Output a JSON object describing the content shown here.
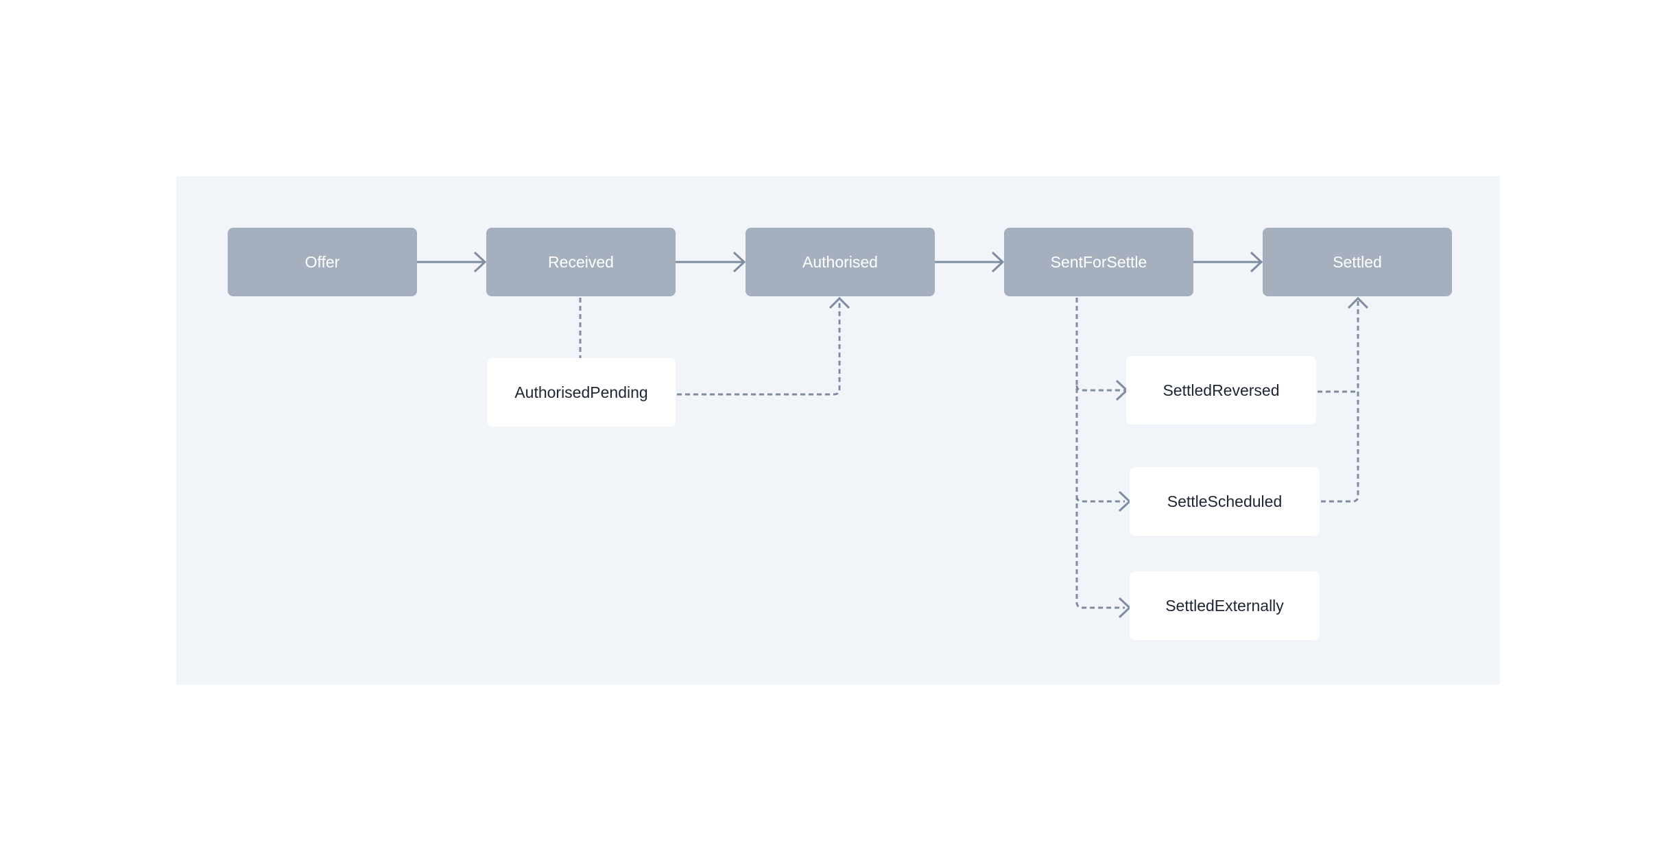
{
  "colors": {
    "panel_bg": "#f1f4f8",
    "main_node": "#a6afbd",
    "sub_node": "#ffffff",
    "edge": "#7f8ba0",
    "sub_text": "#1d2433"
  },
  "nodes": {
    "offer": "Offer",
    "received": "Received",
    "authorised": "Authorised",
    "sent_for_settle": "SentForSettle",
    "settled": "Settled",
    "authorised_pending": "AuthorisedPending",
    "settled_reversed": "SettledReversed",
    "settle_scheduled": "SettleScheduled",
    "settled_externally": "SettledExternally"
  },
  "edges": [
    {
      "from": "Offer",
      "to": "Received",
      "style": "solid"
    },
    {
      "from": "Received",
      "to": "Authorised",
      "style": "solid"
    },
    {
      "from": "Authorised",
      "to": "SentForSettle",
      "style": "solid"
    },
    {
      "from": "SentForSettle",
      "to": "Settled",
      "style": "solid"
    },
    {
      "from": "Received",
      "to": "AuthorisedPending",
      "style": "dashed"
    },
    {
      "from": "AuthorisedPending",
      "to": "Authorised",
      "style": "dashed"
    },
    {
      "from": "SentForSettle",
      "to": "SettledReversed",
      "style": "dashed"
    },
    {
      "from": "SentForSettle",
      "to": "SettleScheduled",
      "style": "dashed"
    },
    {
      "from": "SentForSettle",
      "to": "SettledExternally",
      "style": "dashed"
    },
    {
      "from": "SettledReversed",
      "to": "Settled",
      "style": "dashed"
    },
    {
      "from": "SettleScheduled",
      "to": "Settled",
      "style": "dashed"
    }
  ]
}
